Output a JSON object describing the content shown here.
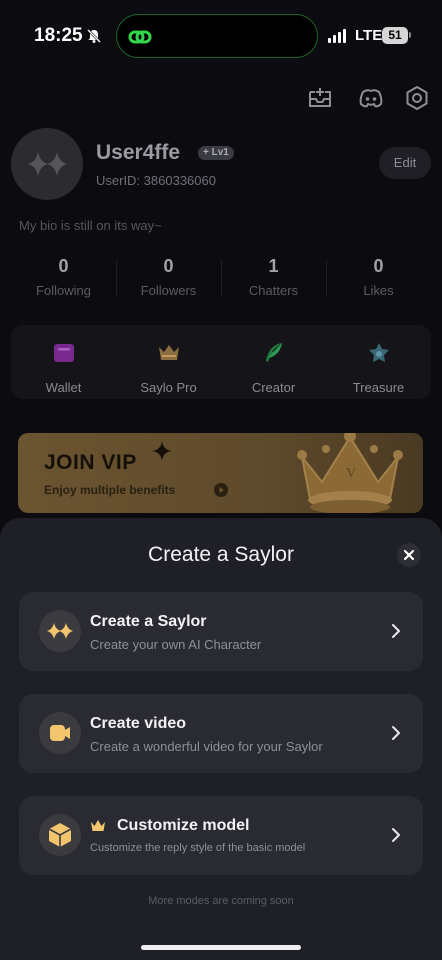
{
  "status_bar": {
    "time": "18:25",
    "network": "LTE",
    "battery": "51"
  },
  "profile": {
    "username": "User4ffe",
    "level": "+ Lv1",
    "user_id": "UserID: 3860336060",
    "edit_label": "Edit",
    "bio": "My bio is still on its way~"
  },
  "stats": [
    {
      "value": "0",
      "label": "Following"
    },
    {
      "value": "0",
      "label": "Followers"
    },
    {
      "value": "1",
      "label": "Chatters"
    },
    {
      "value": "0",
      "label": "Likes"
    }
  ],
  "tools": [
    {
      "label": "Wallet",
      "icon": "wallet-icon",
      "color": "#8a2fa0"
    },
    {
      "label": "Saylo Pro",
      "icon": "crown-icon",
      "color": "#9a7a48"
    },
    {
      "label": "Creator",
      "icon": "quill-icon",
      "color": "#1f7a3e"
    },
    {
      "label": "Treasure",
      "icon": "treasure-icon",
      "color": "#3e6e7a"
    }
  ],
  "vip_banner": {
    "title": "JOIN VIP",
    "subtitle": "Enjoy multiple benefits"
  },
  "sheet": {
    "title": "Create a Saylor",
    "options": [
      {
        "title": "Create a Saylor",
        "description": "Create your own AI Character",
        "icon": "sparkles-icon"
      },
      {
        "title": "Create video",
        "description": "Create a wonderful video for your Saylor",
        "icon": "video-icon"
      },
      {
        "title": "Customize model",
        "description": "Customize the reply style of the basic model",
        "icon": "cube-icon"
      }
    ],
    "footnote": "More modes are coming soon"
  },
  "colors": {
    "accent_gold": "#f3c66e",
    "sheet_bg": "#1f1f27",
    "card_bg": "#2a2a33"
  }
}
